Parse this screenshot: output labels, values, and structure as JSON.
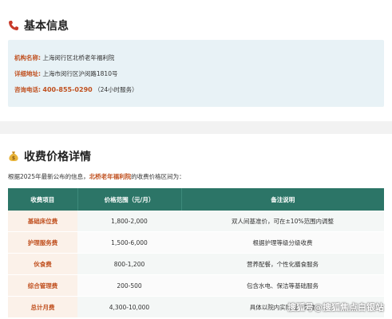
{
  "basic": {
    "title": "基本信息",
    "name_label": "机构名称:",
    "name_value": "上海闵行区北桥老年福利院",
    "addr_label": "详细地址:",
    "addr_value": "上海市闵行区沪闵路1810号",
    "phone_label": "咨询电话:",
    "phone_value": "400-855-0290",
    "phone_note": "（24小时服务）"
  },
  "price": {
    "title": "收费价格详情",
    "intro_before": "根据2025年最新公布的信息，",
    "intro_highlight": "北桥老年福利院",
    "intro_after": "的收费价格区间为：",
    "headers": [
      "收费项目",
      "价格范围（元/月）",
      "备注说明"
    ],
    "rows": [
      {
        "item": "基础床位费",
        "range": "1,800-2,000",
        "note": "双人间基准价，可在±10%范围内调整"
      },
      {
        "item": "护理服务费",
        "range": "1,500-6,000",
        "note": "根据护理等级分级收费"
      },
      {
        "item": "伙食费",
        "range": "800-1,200",
        "note": "营养配餐，个性化膳食服务"
      },
      {
        "item": "综合管理费",
        "range": "200-500",
        "note": "包含水电、保洁等基础服务"
      },
      {
        "item": "总计月费",
        "range": "4,300-10,000",
        "note": "具体以院内实际报价为准"
      }
    ]
  },
  "watermark": "搜狐号@搜狐焦点白银站",
  "icons": {
    "phone": "phone-icon",
    "money": "money-bag-icon"
  },
  "colors": {
    "accent": "#c0501f",
    "table_header": "#2c7567",
    "info_bg": "#e8f2f6"
  }
}
